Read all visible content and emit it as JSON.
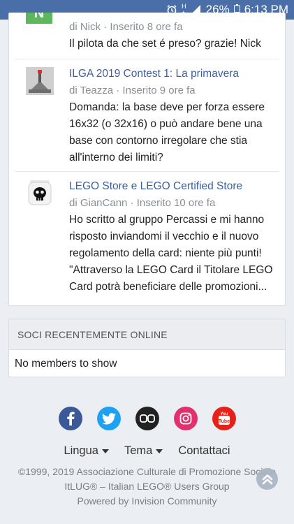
{
  "status_bar": {
    "battery": "26%",
    "time": "6:13 PM"
  },
  "activity": {
    "items": [
      {
        "avatar_letter": "N",
        "title": "",
        "meta": "di Nick · Inserito 8 ore fa",
        "body": "Il pilota da che set é preso?   grazie! Nick"
      },
      {
        "title": "ILGA 2019 Contest 1: La primavera",
        "meta": "di Teazza · Inserito 9 ore fa",
        "body": "Domanda: la base deve per forza essere 16x32 (o 32x16) o può andare bene una base con contorno irregolare che stia all'interno dei limiti?"
      },
      {
        "title": "LEGO Store e LEGO Certified Store",
        "meta": "di GianCann · Inserito 10 ore fa",
        "body": "Ho scritto al gruppo Percassi e mi hanno risposto inviandomi il vecchio e il nuovo regolamento della card: niente più punti! \"Attraverso la LEGO Card il Titolare LEGO Card potrà beneficiare delle promozioni..."
      }
    ]
  },
  "online": {
    "header": "SOCI RECENTEMENTE ONLINE",
    "empty_text": "No members to show"
  },
  "social": [
    {
      "icon": "facebook-icon",
      "color": "#3b5998"
    },
    {
      "icon": "twitter-icon",
      "color": "#1da1f2"
    },
    {
      "icon": "flickr-icon",
      "color": "#222222"
    },
    {
      "icon": "instagram-icon",
      "color": "#e1306c"
    },
    {
      "icon": "youtube-icon",
      "color": "#e62117"
    }
  ],
  "footer": {
    "lingua": "Lingua",
    "tema": "Tema",
    "contattaci": "Contattaci",
    "copyright_line1": "©1999, 2019 Associazione Culturale di Promozione Sociale",
    "copyright_line2": "ItLUG® – Italian LEGO® Users Group",
    "powered": "Powered by Invision Community"
  },
  "colors": {
    "status_bar": "#4a6fa8",
    "link": "#3b5fa0",
    "avatar_green": "#5cb85c"
  }
}
